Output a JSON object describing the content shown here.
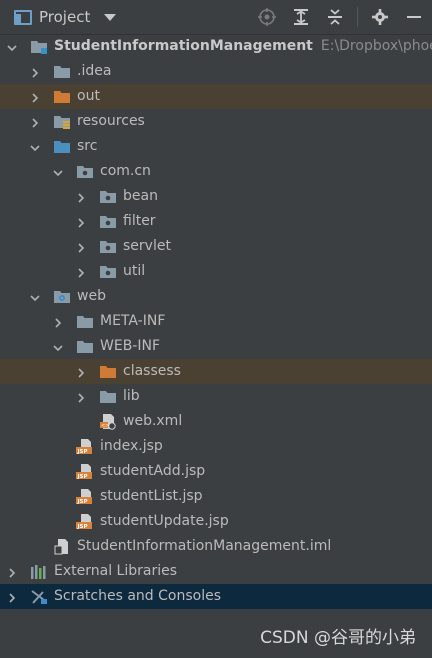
{
  "header": {
    "title": "Project",
    "tools": [
      "locate-icon",
      "expand-all-icon",
      "collapse-all-icon",
      "gear-icon",
      "hide-icon"
    ]
  },
  "tree": [
    {
      "name": "project-root",
      "label": "StudentInformationManagement",
      "path": "E:\\Dropbox\\phoenix",
      "depth": 0,
      "arrow": "down",
      "icon": "module-folder-icon",
      "style": "bold"
    },
    {
      "name": "folder-idea",
      "label": ".idea",
      "depth": 1,
      "arrow": "right",
      "icon": "folder-icon"
    },
    {
      "name": "folder-out",
      "label": "out",
      "depth": 1,
      "arrow": "right",
      "icon": "excluded-folder-icon",
      "highlight": true
    },
    {
      "name": "folder-resources",
      "label": "resources",
      "depth": 1,
      "arrow": "right",
      "icon": "resources-folder-icon"
    },
    {
      "name": "folder-src",
      "label": "src",
      "depth": 1,
      "arrow": "down",
      "icon": "source-folder-icon"
    },
    {
      "name": "package-com-cn",
      "label": "com.cn",
      "depth": 2,
      "arrow": "down",
      "icon": "package-icon"
    },
    {
      "name": "package-bean",
      "label": "bean",
      "depth": 3,
      "arrow": "right",
      "icon": "package-icon"
    },
    {
      "name": "package-filter",
      "label": "filter",
      "depth": 3,
      "arrow": "right",
      "icon": "package-icon"
    },
    {
      "name": "package-servlet",
      "label": "servlet",
      "depth": 3,
      "arrow": "right",
      "icon": "package-icon"
    },
    {
      "name": "package-util",
      "label": "util",
      "depth": 3,
      "arrow": "right",
      "icon": "package-icon"
    },
    {
      "name": "folder-web",
      "label": "web",
      "depth": 1,
      "arrow": "down",
      "icon": "web-folder-icon"
    },
    {
      "name": "folder-meta-inf",
      "label": "META-INF",
      "depth": 2,
      "arrow": "right",
      "icon": "folder-icon"
    },
    {
      "name": "folder-web-inf",
      "label": "WEB-INF",
      "depth": 2,
      "arrow": "down",
      "icon": "folder-icon"
    },
    {
      "name": "folder-classess",
      "label": "classess",
      "depth": 3,
      "arrow": "right",
      "icon": "excluded-folder-icon",
      "highlight": true
    },
    {
      "name": "folder-lib",
      "label": "lib",
      "depth": 3,
      "arrow": "right",
      "icon": "folder-icon"
    },
    {
      "name": "file-web-xml",
      "label": "web.xml",
      "depth": 3,
      "arrow": "none",
      "icon": "xml-file-icon"
    },
    {
      "name": "file-index-jsp",
      "label": "index.jsp",
      "depth": 2,
      "arrow": "none",
      "icon": "jsp-file-icon"
    },
    {
      "name": "file-studentadd-jsp",
      "label": "studentAdd.jsp",
      "depth": 2,
      "arrow": "none",
      "icon": "jsp-file-icon"
    },
    {
      "name": "file-studentlist-jsp",
      "label": "studentList.jsp",
      "depth": 2,
      "arrow": "none",
      "icon": "jsp-file-icon"
    },
    {
      "name": "file-studentupdate-jsp",
      "label": "studentUpdate.jsp",
      "depth": 2,
      "arrow": "none",
      "icon": "jsp-file-icon"
    },
    {
      "name": "file-iml",
      "label": "StudentInformationManagement.iml",
      "depth": 1,
      "arrow": "none",
      "icon": "iml-file-icon"
    },
    {
      "name": "external-libraries",
      "label": "External Libraries",
      "depth": 0,
      "arrow": "right",
      "icon": "libraries-icon"
    },
    {
      "name": "scratches-and-consoles",
      "label": "Scratches and Consoles",
      "depth": 0,
      "arrow": "right",
      "icon": "scratches-icon",
      "selected": true
    }
  ],
  "watermark": "CSDN @谷哥的小弟",
  "colors": {
    "background": "#3c3f41",
    "text": "#bbbbbb",
    "highlight_row": "#4b4132",
    "selected_row": "#0d293e",
    "folder": "#8a9ba8",
    "source_folder": "#4a8fbd",
    "excluded_folder": "#d07b35"
  }
}
